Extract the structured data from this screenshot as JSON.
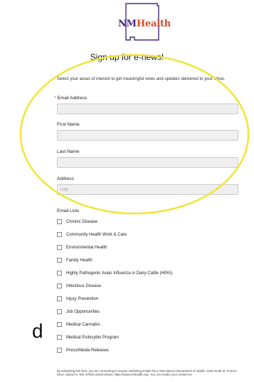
{
  "logo": {
    "part1": "NM",
    "part2": "Health"
  },
  "form": {
    "title": "Sign up for e-news!",
    "intro": "Select your areas of interest to get meaningful news and updates delivered to your inbox.",
    "required_mark": "*",
    "fields": {
      "email": {
        "label": "Email Address",
        "value": "",
        "placeholder": ""
      },
      "first_name": {
        "label": "First Name",
        "value": "",
        "placeholder": ""
      },
      "last_name": {
        "label": "Last Name",
        "value": "",
        "placeholder": ""
      },
      "address": {
        "label": "Address",
        "value": "",
        "placeholder": "City"
      }
    },
    "email_lists": {
      "heading": "Email Lists",
      "items": [
        "Chronic Disease",
        "Community Health Work & Care",
        "Environmental Health",
        "Family Health",
        "Highly Pathogenic Avian Influenza in Dairy Cattle (HPAI)",
        "Infectious Disease",
        "Injury Prevention",
        "Job Opportunities",
        "Medical Cannabis",
        "Medical Psilocybin Program",
        "Press/Media Releases"
      ]
    },
    "disclaimer": "By submitting this form, you are consenting to receive marketing emails from: New Mexico Department of Health, 1190 South St. Francis Drive, Santa Fe, NM, 87505 United States, https://www.nmhealth.org/. You can revoke your consent to"
  },
  "overlay": {
    "side_text": "d",
    "highlight_color": "#f1e535"
  },
  "colors": {
    "brand_purple": "#4a2a7a",
    "brand_orange": "#d84b2a"
  }
}
